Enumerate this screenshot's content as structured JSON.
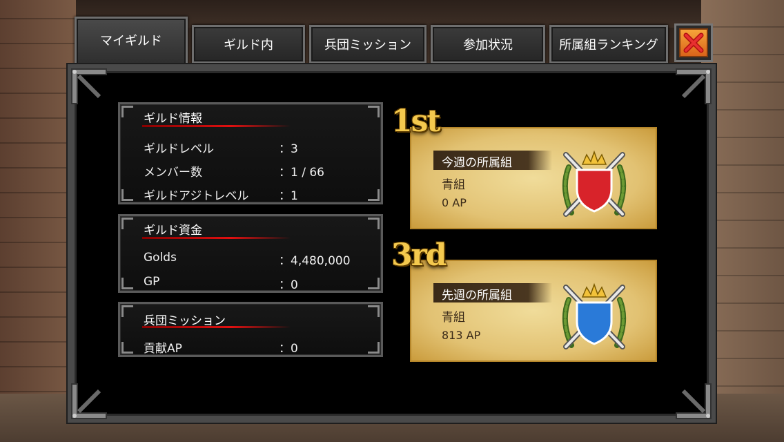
{
  "tabs": [
    {
      "label": "マイギルド",
      "active": true
    },
    {
      "label": "ギルド内",
      "active": false
    },
    {
      "label": "兵団ミッション",
      "active": false
    },
    {
      "label": "参加状況",
      "active": false
    },
    {
      "label": "所属組ランキング",
      "active": false
    }
  ],
  "guild_info": {
    "title": "ギルド情報",
    "rows": [
      {
        "label": "ギルドレベル",
        "value": "：3"
      },
      {
        "label": "メンバー数",
        "value": "：1 / 66"
      },
      {
        "label": "ギルドアジトレベル",
        "value": "：1"
      }
    ]
  },
  "guild_funds": {
    "title": "ギルド資金",
    "rows": [
      {
        "label": "Golds",
        "value": "：4,480,000"
      },
      {
        "label": "GP",
        "value": "：0"
      }
    ]
  },
  "mission": {
    "title": "兵団ミッション",
    "rows": [
      {
        "label": "貢献AP",
        "value": "：0"
      }
    ]
  },
  "this_week": {
    "rank": "1st",
    "heading": "今週の所属組",
    "team": "青組",
    "ap": "0 AP",
    "shield_color": "#d8232a"
  },
  "last_week": {
    "rank": "3rd",
    "heading": "先週の所属組",
    "team": "青組",
    "ap": "813 AP",
    "shield_color": "#2a7ad8"
  },
  "colors": {
    "accent_red": "#e01010",
    "close_orange": "#e87a26",
    "gold": "#f4c94e"
  }
}
